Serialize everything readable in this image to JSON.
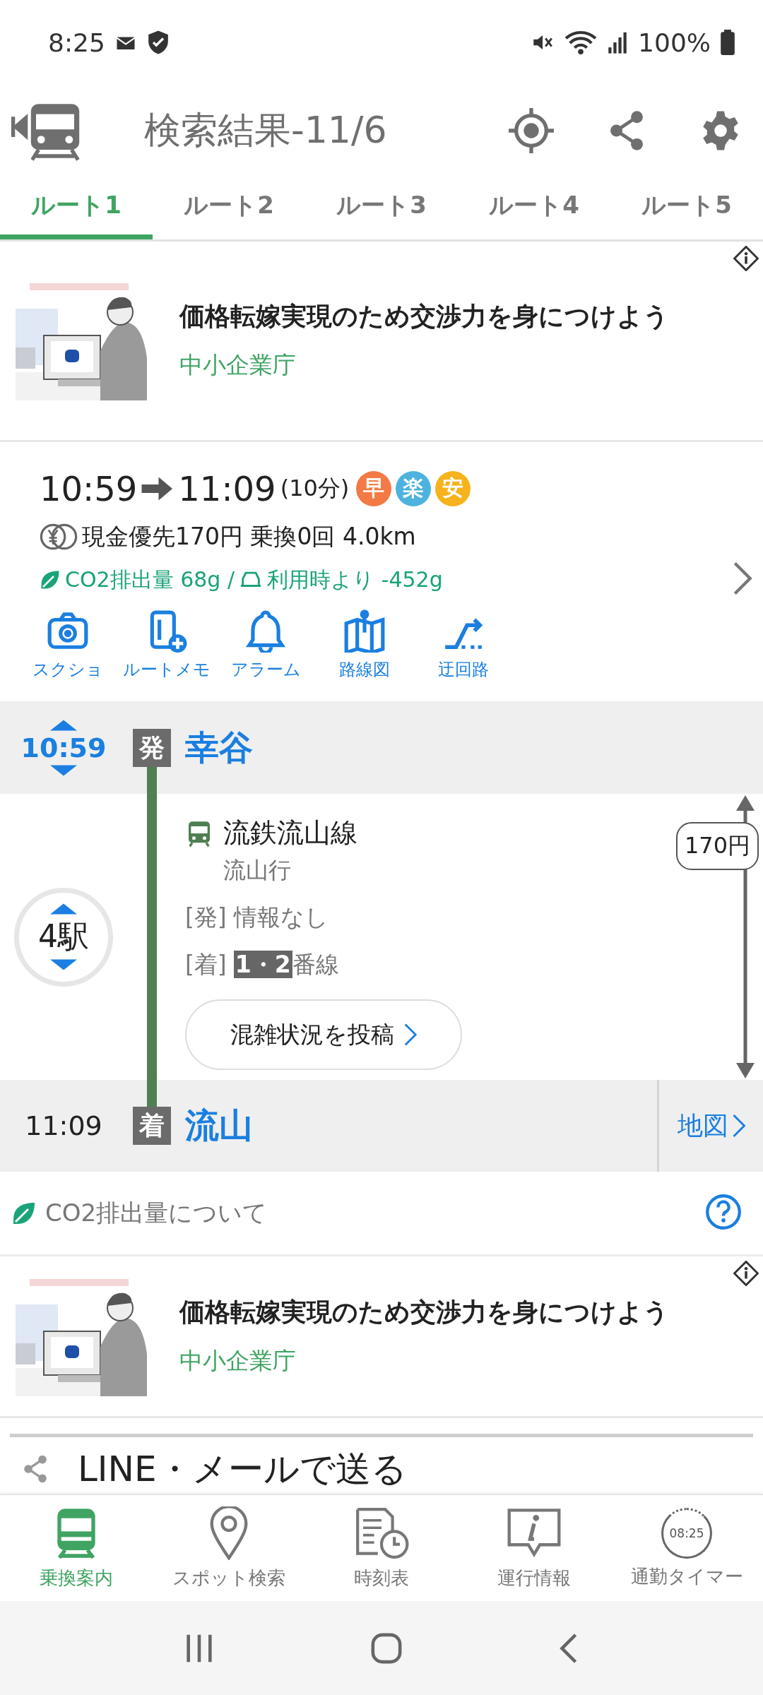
{
  "status_bar": {
    "time": "8:25",
    "battery": "100%"
  },
  "app_bar": {
    "title": "検索結果-11/6"
  },
  "tabs": [
    {
      "label": "ルート1",
      "selected": true
    },
    {
      "label": "ルート2",
      "selected": false
    },
    {
      "label": "ルート3",
      "selected": false
    },
    {
      "label": "ルート4",
      "selected": false
    },
    {
      "label": "ルート5",
      "selected": false
    }
  ],
  "top_ad": {
    "kind": "picture",
    "headline": "価格転嫁実現のため交渉力を身につけよう",
    "sponsor": "中小企業庁"
  },
  "summary": {
    "depart": "10:59",
    "arrive": "11:09",
    "duration": "(10分)",
    "badges": [
      {
        "label": "早",
        "color": "#f37a45"
      },
      {
        "label": "楽",
        "color": "#4db3de"
      },
      {
        "label": "安",
        "color": "#f6b31c"
      }
    ],
    "fare_line": "現金優先170円 乗換0回 4.0km",
    "co2": "CO2排出量 68g /",
    "co2_car": "利用時より -452g",
    "actions": [
      {
        "label": "スクショ",
        "kind": "camera"
      },
      {
        "label": "ルートメモ",
        "kind": "memo"
      },
      {
        "label": "アラーム",
        "kind": "bell"
      },
      {
        "label": "路線図",
        "kind": "map"
      },
      {
        "label": "迂回路",
        "kind": "detour"
      }
    ]
  },
  "route": {
    "departure": {
      "time": "10:59",
      "mark": "発",
      "station": "幸谷"
    },
    "segment": {
      "line": "流鉄流山線",
      "direction": "流山行",
      "stops": "4駅",
      "depart_tag": "[発]",
      "depart_text": "情報なし",
      "arrive_tag": "[着]",
      "platform": "1・2",
      "platform_suffix": "番線",
      "fare": "170円",
      "crowd_button": "混雑状況を投稿"
    },
    "arrival": {
      "time": "11:09",
      "mark": "着",
      "station": "流山",
      "map_link": "地図"
    }
  },
  "co2_link": "CO2排出量について",
  "bottom_ad": {
    "kind": "picture",
    "headline": "価格転嫁実現のため交渉力を身につけよう",
    "sponsor": "中小企業庁"
  },
  "share": {
    "label": "LINE・メールで送る"
  },
  "bottom_nav": [
    {
      "label": "乗換案内",
      "kind": "train",
      "selected": true
    },
    {
      "label": "スポット検索",
      "kind": "pin",
      "selected": false
    },
    {
      "label": "時刻表",
      "kind": "timetable",
      "selected": false
    },
    {
      "label": "運行情報",
      "kind": "info",
      "selected": false
    },
    {
      "label": "通勤タイマー",
      "kind": "timer",
      "clock": "08:25",
      "selected": false
    }
  ]
}
